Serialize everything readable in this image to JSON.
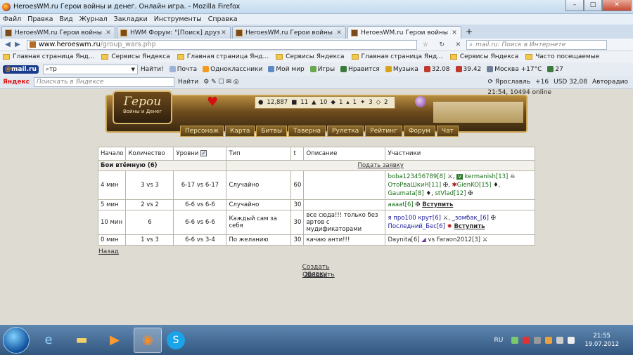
{
  "window": {
    "title": "HeroesWM.ru Герои войны и денег. Онлайн игра. - Mozilla Firefox"
  },
  "menu": [
    "Файл",
    "Правка",
    "Вид",
    "Журнал",
    "Закладки",
    "Инструменты",
    "Справка"
  ],
  "tabs": [
    {
      "label": "HeroesWM.ru Герои войны ...",
      "active": false
    },
    {
      "label": "HWM Форум: \"[Поиск] друз...",
      "active": false
    },
    {
      "label": "HeroesWM.ru Герои войны ...",
      "active": false
    },
    {
      "label": "HeroesWM.ru Герои войны ...",
      "active": true
    }
  ],
  "address": {
    "host": "www.heroeswm.ru",
    "path": "/group_wars.php"
  },
  "search_placeholder": "mail.ru: Поиск в Интернете",
  "bookmarks": [
    "Главная страница Янд...",
    "Сервисы Яндекса",
    "Главная страница Янд...",
    "Сервисы Яндекса",
    "Главная страница Янд...",
    "Сервисы Яндекса",
    "Часто посещаемые"
  ],
  "mailbar": {
    "logo": "mail.ru",
    "query": "тр",
    "find": "Найти!",
    "items": [
      "Почта",
      "Одноклассники",
      "Мой мир",
      "Игры",
      "Нравится",
      "Музыка",
      "32.08",
      "39.42",
      "Москва +17°C",
      "27"
    ]
  },
  "yabar": {
    "logo": "Яндекс",
    "placeholder": "Поискать в Яндексе",
    "find": "Найти",
    "items": [
      "Ярославль",
      "+16",
      "USD 32,08",
      "Авторадио"
    ]
  },
  "game": {
    "clock": "21:54, 10494 online",
    "logo_big": "Герои",
    "logo_small": "Войны и Денег",
    "resources": [
      "12,887",
      "11",
      "10",
      "1",
      "1",
      "3",
      "2"
    ],
    "nav": [
      "Персонаж",
      "Карта",
      "Битвы",
      "Таверна",
      "Рулетка",
      "Рейтинг",
      "Форум",
      "Чат"
    ],
    "table": {
      "headers": [
        "Начало",
        "Количество",
        "Уровни",
        "Тип",
        "t",
        "Описание",
        "Участники"
      ],
      "group_title": "Бои втёмную (6)",
      "submit": "Подать заявку",
      "rows": [
        {
          "start": "4 мин",
          "count": "3 vs 3",
          "levels": "6-17 vs 6-17",
          "type": "Случайно",
          "t": "60",
          "desc": "",
          "p1": "boba123456789[8]",
          "p2": "kermanish[13]",
          "p3": "ОтоРваШкиН[11]",
          "p4": "GienKO[15]",
          "p5": "Gaumata[8]",
          "p6": "stVlad[12]"
        },
        {
          "start": "5 мин",
          "count": "2 vs 2",
          "levels": "6-6 vs 6-6",
          "type": "Случайно",
          "t": "30",
          "desc": "",
          "p1": "ааааt[6]",
          "join": "Вступить"
        },
        {
          "start": "10 мин",
          "count": "6",
          "levels": "6-6 vs 6-6",
          "type": "Каждый сам за себя",
          "t": "30",
          "desc": "все сюда!!! только без артов с мудификаторами",
          "p1": "я про100 крут[6]",
          "p2": "_зомбак_[6]",
          "p3": "Последний_Бес[6]",
          "join": "Вступить"
        },
        {
          "start": "0 мин",
          "count": "1 vs 3",
          "levels": "6-6 vs 3-4",
          "type": "По желанию",
          "t": "30",
          "desc": "качаю анти!!!",
          "p1": "Daynita[6]",
          "vs": "vs",
          "p2": "Faraon2012[3]"
        }
      ]
    },
    "back": "Назад",
    "create": "Создать заявку",
    "refresh": "Обновить"
  },
  "taskbar": {
    "lang": "RU",
    "time": "21:55",
    "date": "19.07.2012"
  }
}
